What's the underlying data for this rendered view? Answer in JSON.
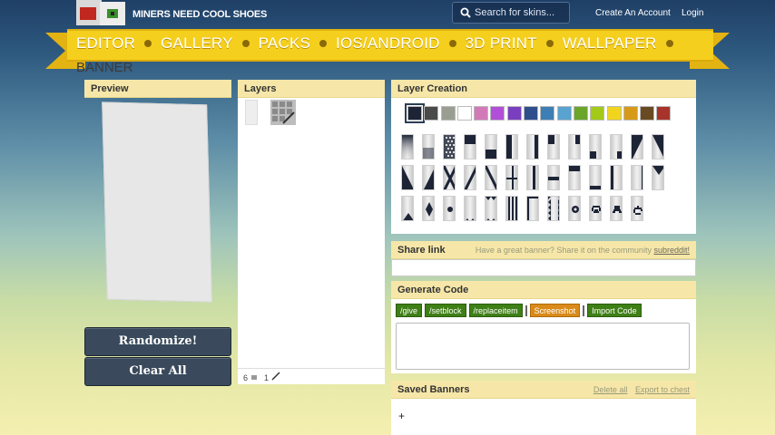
{
  "header": {
    "site_title": "MINERS NEED COOL SHOES",
    "search_placeholder": "Search for skins...",
    "create_account": "Create An Account",
    "login": "Login"
  },
  "nav": {
    "items": [
      "EDITOR",
      "GALLERY",
      "PACKS",
      "IOS/ANDROID",
      "3D PRINT",
      "WALLPAPER"
    ],
    "wrapped_item": "BANNER"
  },
  "preview": {
    "title": "Preview",
    "randomize_label": "Randomize!",
    "clear_label": "Clear All"
  },
  "layers": {
    "title": "Layers",
    "footer_count_a": "6",
    "footer_count_b": "1"
  },
  "creation": {
    "title": "Layer Creation",
    "colors": [
      "#1d2436",
      "#4a4a4a",
      "#9a9e91",
      "#ffffff",
      "#d27ab8",
      "#b24fd8",
      "#7a3fc0",
      "#2e4f8c",
      "#3d7fb4",
      "#58a3cf",
      "#6aa62a",
      "#a3c919",
      "#f1d41c",
      "#d79a18",
      "#6a4a22",
      "#a8332b"
    ],
    "selected_color_index": 0
  },
  "share": {
    "title": "Share link",
    "hint": "Have a great banner? Share it on the community",
    "hint_link": "subreddit!"
  },
  "generate": {
    "title": "Generate Code",
    "give": "/give",
    "setblock": "/setblock",
    "replaceitem": "/replaceitem",
    "screenshot": "Screenshot",
    "import": "Import Code"
  },
  "saved": {
    "title": "Saved Banners",
    "delete_all": "Delete all",
    "export": "Export to chest",
    "add": "+"
  }
}
